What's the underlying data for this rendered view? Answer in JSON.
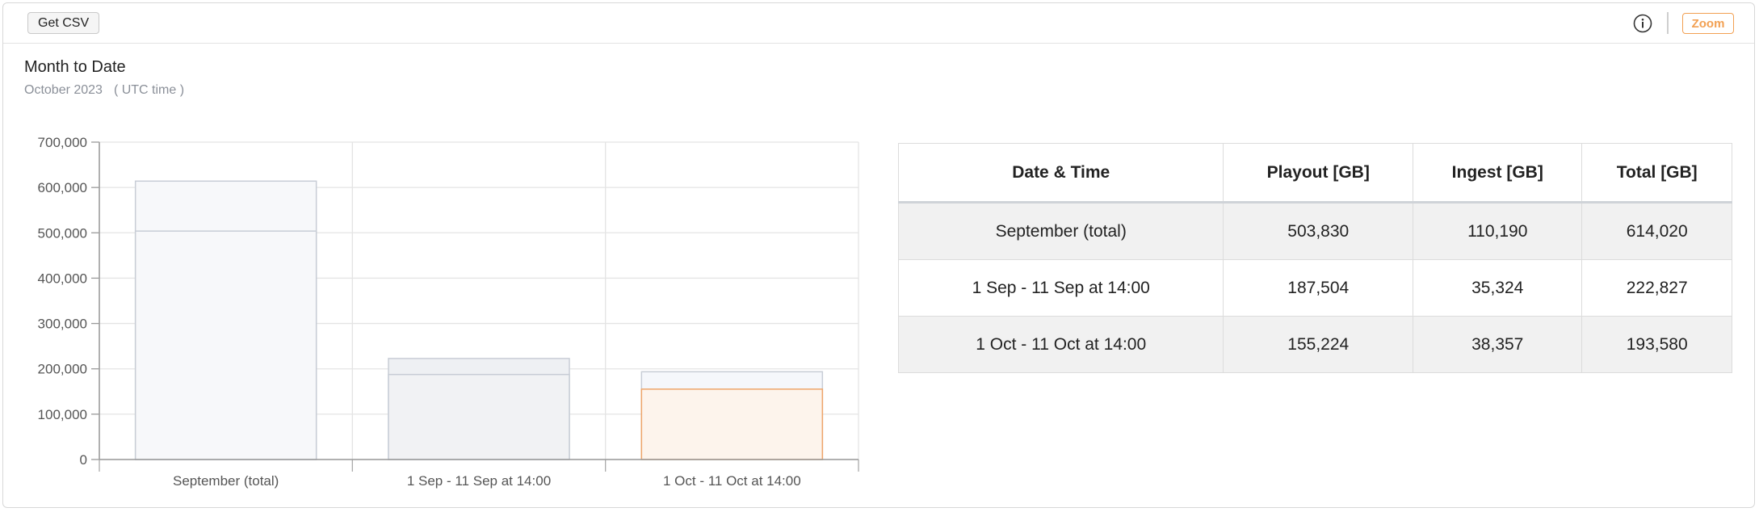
{
  "toolbar": {
    "csv_label": "Get CSV",
    "zoom_label": "Zoom",
    "info_icon": "info-icon",
    "accent_color": "#f2a052"
  },
  "header": {
    "title": "Month to Date",
    "month": "October 2023",
    "timezone": "( UTC time )"
  },
  "chart_data": {
    "type": "bar",
    "categories": [
      "September (total)",
      "1 Sep - 11 Sep at 14:00",
      "1 Oct - 11 Oct at 14:00"
    ],
    "series": [
      {
        "values": [
          614020,
          222827,
          193580
        ]
      },
      {
        "values": [
          503830,
          187504,
          155224
        ]
      }
    ],
    "ylim": [
      0,
      700000
    ],
    "yticks": [
      0,
      100000,
      200000,
      300000,
      400000,
      500000,
      600000,
      700000
    ],
    "ytick_labels": [
      "0",
      "100,000",
      "200,000",
      "300,000",
      "400,000",
      "500,000",
      "600,000",
      "700,000"
    ],
    "grid": true,
    "colors": {
      "default_fill": "#f7f8fa",
      "default_stroke": "#c8cdd6",
      "highlight_fill": "#fdf4ec",
      "highlight_stroke": "#eea56a"
    }
  },
  "table": {
    "headers": [
      "Date & Time",
      "Playout [GB]",
      "Ingest [GB]",
      "Total [GB]"
    ],
    "rows": [
      [
        "September (total)",
        "503,830",
        "110,190",
        "614,020"
      ],
      [
        "1 Sep - 11 Sep at 14:00",
        "187,504",
        "35,324",
        "222,827"
      ],
      [
        "1 Oct - 11 Oct at 14:00",
        "155,224",
        "38,357",
        "193,580"
      ]
    ]
  }
}
